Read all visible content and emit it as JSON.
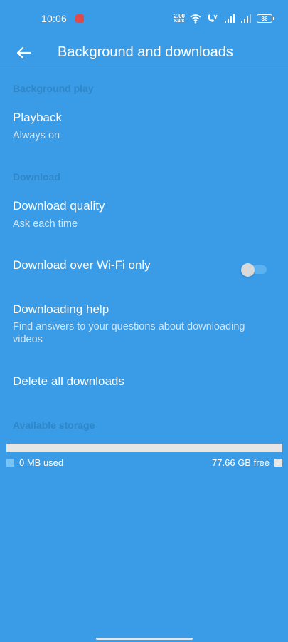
{
  "status_bar": {
    "time": "10:06",
    "net_speed_value": "2.00",
    "net_speed_unit": "KB/S",
    "battery": "86"
  },
  "header": {
    "title": "Background and downloads"
  },
  "sections": {
    "background_play": "Background play",
    "download": "Download",
    "available_storage": "Available storage"
  },
  "settings": {
    "playback": {
      "title": "Playback",
      "subtitle": "Always on"
    },
    "download_quality": {
      "title": "Download quality",
      "subtitle": "Ask each time"
    },
    "wifi_only": {
      "title": "Download over Wi-Fi only",
      "enabled": false
    },
    "help": {
      "title": "Downloading help",
      "subtitle": "Find answers to your questions about downloading videos"
    },
    "delete_all": {
      "title": "Delete all downloads"
    }
  },
  "storage": {
    "used_label": "0 MB used",
    "free_label": "77.66 GB free",
    "used_fraction": 0
  },
  "colors": {
    "background": "#3a9be6",
    "section_header": "#2f86c8",
    "storage_free": "#e6e6e6",
    "storage_used": "#78c4f5"
  }
}
